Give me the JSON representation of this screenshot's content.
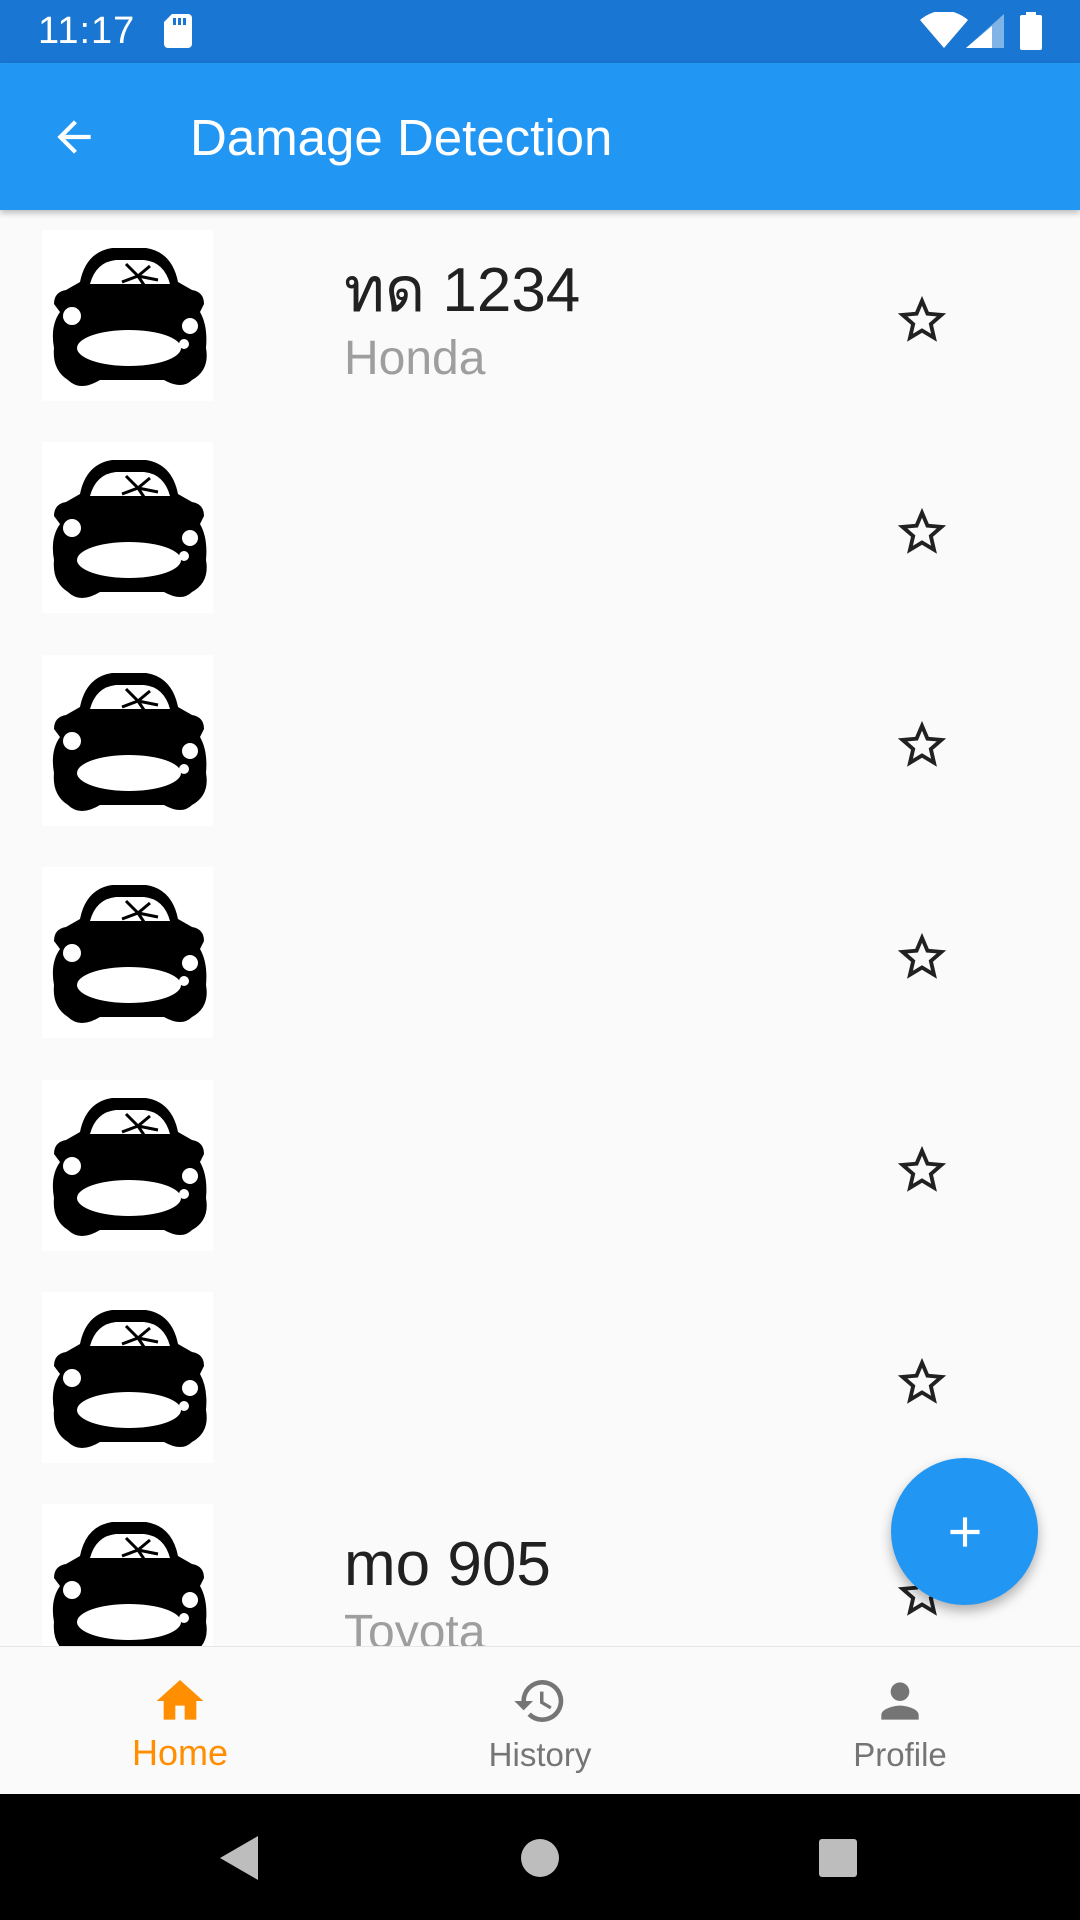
{
  "status_bar": {
    "time": "11:17",
    "icons": [
      "sd-card-icon",
      "wifi-icon",
      "cell-signal-icon",
      "battery-icon"
    ]
  },
  "app_bar": {
    "title": "Damage Detection",
    "back_icon": "arrow-back-icon"
  },
  "cars": [
    {
      "plate": "ทด 1234",
      "make": "Honda",
      "favorite": false
    },
    {
      "plate": "",
      "make": "",
      "favorite": false
    },
    {
      "plate": "",
      "make": "",
      "favorite": false
    },
    {
      "plate": "",
      "make": "",
      "favorite": false
    },
    {
      "plate": "",
      "make": "",
      "favorite": false
    },
    {
      "plate": "",
      "make": "",
      "favorite": false
    },
    {
      "plate": "mo 905",
      "make": "Toyota",
      "favorite": false
    }
  ],
  "fab": {
    "icon": "add-icon"
  },
  "bottom_nav": {
    "items": [
      {
        "label": "Home",
        "icon": "home-icon",
        "active": true
      },
      {
        "label": "History",
        "icon": "history-icon",
        "active": false
      },
      {
        "label": "Profile",
        "icon": "person-icon",
        "active": false
      }
    ]
  },
  "colors": {
    "status_bar": "#1976d2",
    "app_bar": "#2196f3",
    "accent": "#ff8f00",
    "inactive": "#757575"
  }
}
